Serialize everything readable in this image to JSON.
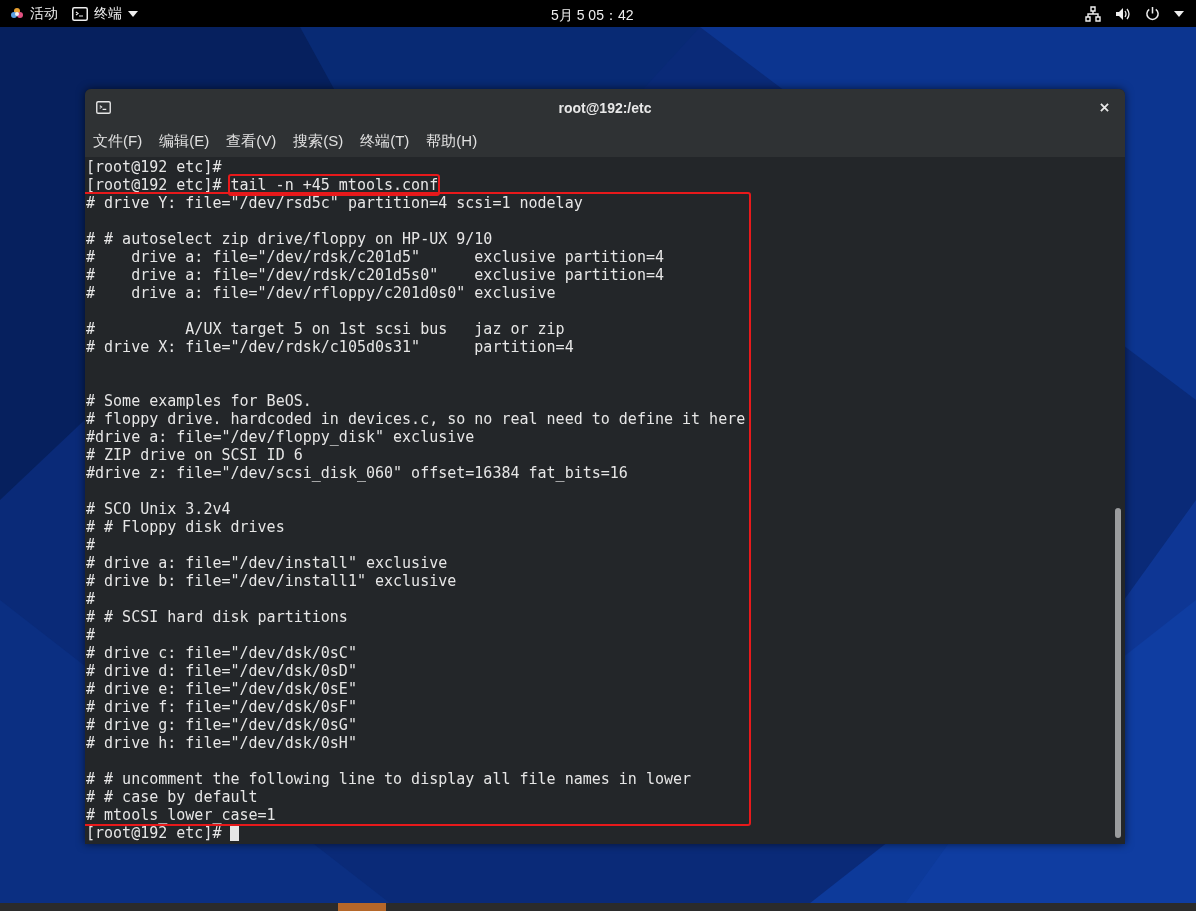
{
  "top_bar": {
    "activities": "活动",
    "app_menu": "终端",
    "clock": "5月 5 05：42"
  },
  "window": {
    "title": "root@192:/etc",
    "menu": [
      "文件(F)",
      "编辑(E)",
      "查看(V)",
      "搜索(S)",
      "终端(T)",
      "帮助(H)"
    ],
    "terminal": {
      "before": [
        {
          "prompt": "[root@192 etc]#"
        },
        {
          "prompt": "[root@192 etc]#",
          "command": "tail -n +45 mtools.conf",
          "highlighted": true
        }
      ],
      "output": {
        "highlighted": true,
        "lines": [
          {
            "kind": "text",
            "text": "# drive Y: file=\"/dev/rsd5c\" partition=4 scsi=1 nodelay"
          },
          {
            "kind": "blank"
          },
          {
            "kind": "text",
            "text": "# # autoselect zip drive/floppy on HP-UX 9/10"
          },
          {
            "kind": "text",
            "text": "#    drive a: file=\"/dev/rdsk/c201d5\"      exclusive partition=4"
          },
          {
            "kind": "text",
            "text": "#    drive a: file=\"/dev/rdsk/c201d5s0\"    exclusive partition=4"
          },
          {
            "kind": "text",
            "text": "#    drive a: file=\"/dev/rfloppy/c201d0s0\" exclusive"
          },
          {
            "kind": "blank"
          },
          {
            "kind": "text",
            "text": "#          A/UX target 5 on 1st scsi bus   jaz or zip"
          },
          {
            "kind": "text",
            "text": "# drive X: file=\"/dev/rdsk/c105d0s31\"      partition=4"
          },
          {
            "kind": "blank"
          },
          {
            "kind": "blank"
          },
          {
            "kind": "text",
            "text": "# Some examples for BeOS."
          },
          {
            "kind": "text",
            "text": "# floppy drive. hardcoded in devices.c, so no real need to define it here"
          },
          {
            "kind": "text",
            "text": "#drive a: file=\"/dev/floppy_disk\" exclusive"
          },
          {
            "kind": "text",
            "text": "# ZIP drive on SCSI ID 6"
          },
          {
            "kind": "text",
            "text": "#drive z: file=\"/dev/scsi_disk_060\" offset=16384 fat_bits=16"
          },
          {
            "kind": "blank"
          },
          {
            "kind": "text",
            "text": "# SCO Unix 3.2v4"
          },
          {
            "kind": "text",
            "text": "# # Floppy disk drives"
          },
          {
            "kind": "text",
            "text": "#"
          },
          {
            "kind": "text",
            "text": "# drive a: file=\"/dev/install\" exclusive"
          },
          {
            "kind": "text",
            "text": "# drive b: file=\"/dev/install1\" exclusive"
          },
          {
            "kind": "text",
            "text": "#"
          },
          {
            "kind": "text",
            "text": "# # SCSI hard disk partitions"
          },
          {
            "kind": "text",
            "text": "#"
          },
          {
            "kind": "text",
            "text": "# drive c: file=\"/dev/dsk/0sC\""
          },
          {
            "kind": "text",
            "text": "# drive d: file=\"/dev/dsk/0sD\""
          },
          {
            "kind": "text",
            "text": "# drive e: file=\"/dev/dsk/0sE\""
          },
          {
            "kind": "text",
            "text": "# drive f: file=\"/dev/dsk/0sF\""
          },
          {
            "kind": "text",
            "text": "# drive g: file=\"/dev/dsk/0sG\""
          },
          {
            "kind": "text",
            "text": "# drive h: file=\"/dev/dsk/0sH\""
          },
          {
            "kind": "blank"
          },
          {
            "kind": "text",
            "text": "# # uncomment the following line to display all file names in lower"
          },
          {
            "kind": "text",
            "text": "# # case by default"
          },
          {
            "kind": "text",
            "text": "# mtools_lower_case=1"
          }
        ]
      },
      "after": {
        "prompt": "[root@192 etc]#",
        "cursor": true
      }
    }
  }
}
